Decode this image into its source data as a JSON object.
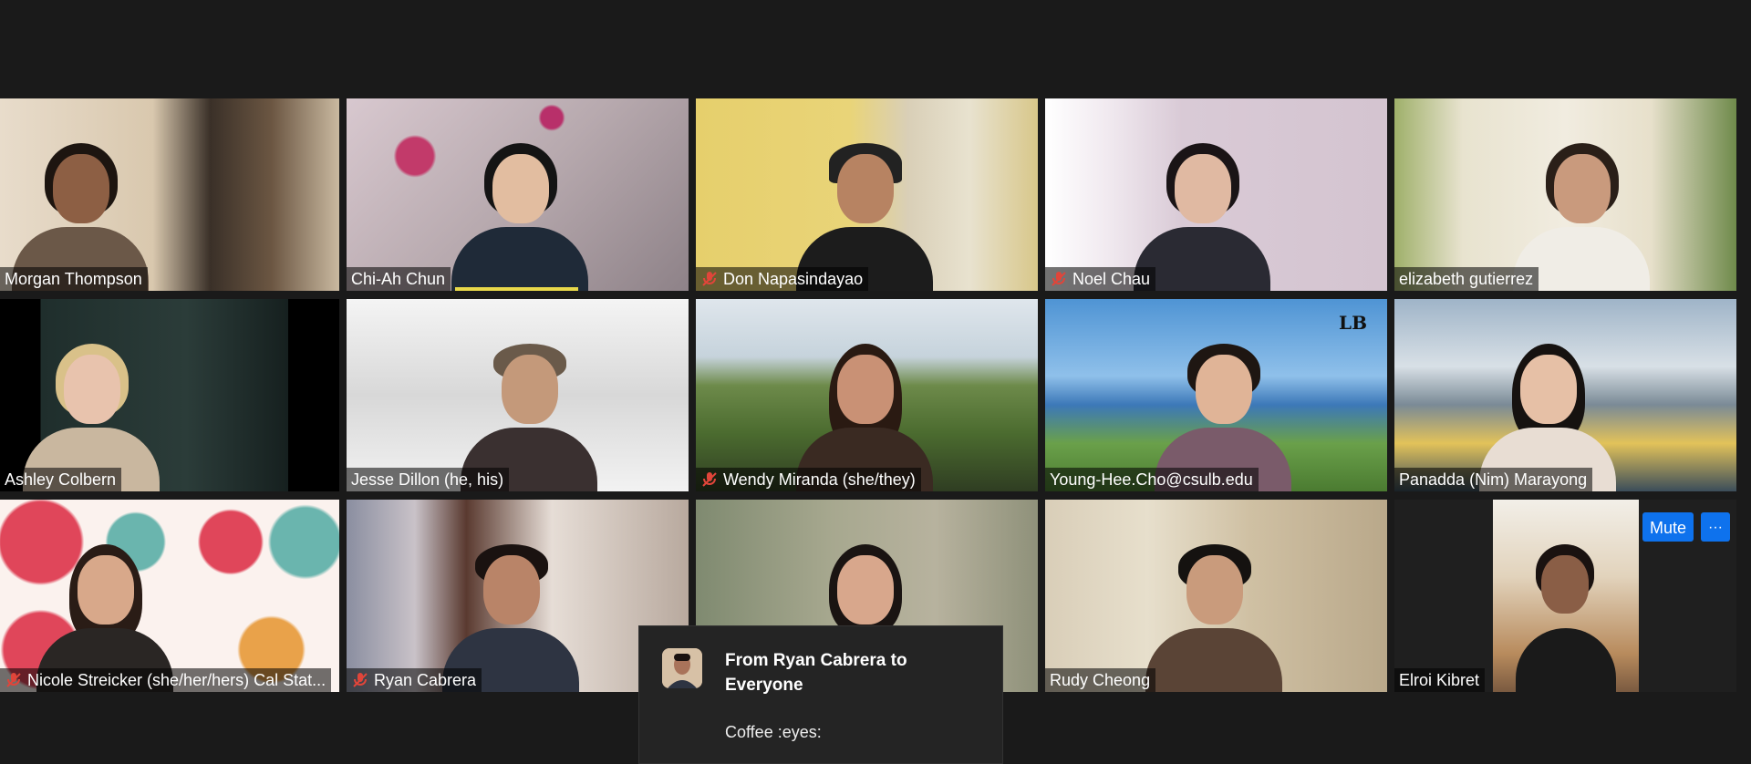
{
  "participants": [
    {
      "name": "Morgan Thompson",
      "muted": false
    },
    {
      "name": "Chi-Ah Chun",
      "muted": false
    },
    {
      "name": "Don Napasindayao",
      "muted": true
    },
    {
      "name": "Noel Chau",
      "muted": true
    },
    {
      "name": "elizabeth gutierrez",
      "muted": false
    },
    {
      "name": "Ashley Colbern",
      "muted": false
    },
    {
      "name": "Jesse Dillon (he, his)",
      "muted": false
    },
    {
      "name": "Wendy Miranda (she/they)",
      "muted": true
    },
    {
      "name": "Young-Hee.Cho@csulb.edu",
      "muted": false
    },
    {
      "name": "Panadda (Nim) Marayong",
      "muted": false
    },
    {
      "name": "Nicole Streicker (she/her/hers) Cal Stat...",
      "muted": true
    },
    {
      "name": "Ryan Cabrera",
      "muted": true
    },
    {
      "name": "",
      "muted": false
    },
    {
      "name": "Rudy Cheong",
      "muted": false
    },
    {
      "name": "Elroi Kibret",
      "muted": false
    }
  ],
  "tile_controls": {
    "mute_label": "Mute",
    "more_label": "···"
  },
  "active_logo_text": "LB",
  "chat_popup": {
    "from": "From Ryan Cabrera to Everyone",
    "message": "Coffee :eyes:"
  },
  "colors": {
    "background": "#1a1a1a",
    "active_speaker_border": "#e6f07a",
    "muted_icon": "#e0453a",
    "button_blue": "#0e72ed"
  }
}
